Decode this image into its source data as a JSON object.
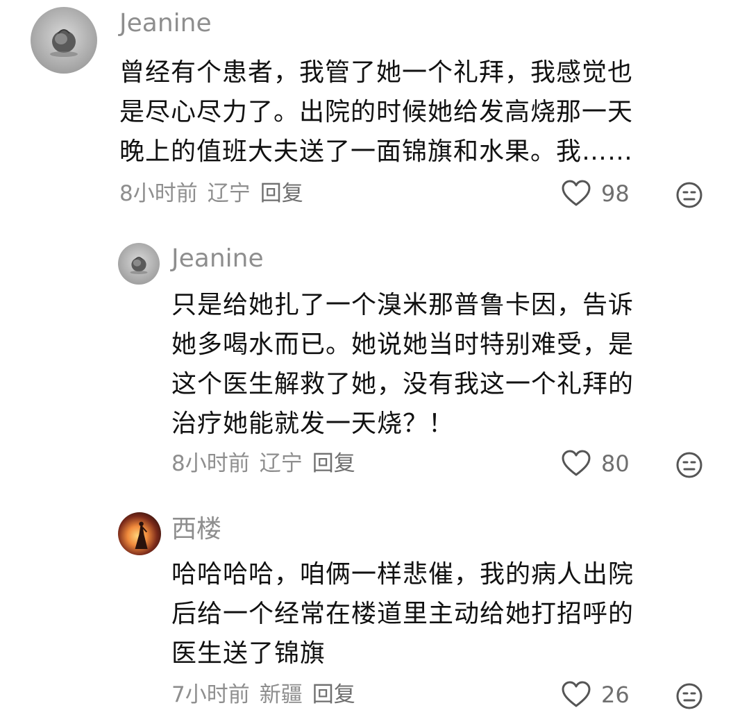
{
  "comments": [
    {
      "username": "Jeanine",
      "lines": [
        "曾经有个患者，我管了她一个礼拜，我感觉也",
        "是尽心尽力了。出院的时候她给发高烧那一天",
        "晚上的值班大夫送了一面锦旗和水果。我……"
      ],
      "time": "8小时前",
      "location": "辽宁",
      "reply_label": "回复",
      "likes": "98",
      "avatar_icon": "grey-sketch-avatar"
    },
    {
      "username": "Jeanine",
      "lines": [
        "只是给她扎了一个溴米那普鲁卡因，告诉",
        "她多喝水而已。她说她当时特别难受，是",
        "这个医生解救了她，没有我这一个礼拜的",
        "治疗她能就发一天烧？！"
      ],
      "time": "8小时前",
      "location": "辽宁",
      "reply_label": "回复",
      "likes": "80",
      "avatar_icon": "grey-sketch-avatar"
    },
    {
      "username": "西楼",
      "lines": [
        "哈哈哈哈，咱俩一样悲催，我的病人出院",
        "后给一个经常在楼道里主动给她打招呼的",
        "医生送了锦旗"
      ],
      "time": "7小时前",
      "location": "新疆",
      "reply_label": "回复",
      "likes": "26",
      "avatar_icon": "sunset-silhouette-avatar"
    }
  ],
  "icons": {
    "like": "heart-outline-icon",
    "emoji": "neutral-face-icon"
  },
  "colors": {
    "text": "#111111",
    "muted": "#8e8e8e",
    "icon": "#555555"
  }
}
